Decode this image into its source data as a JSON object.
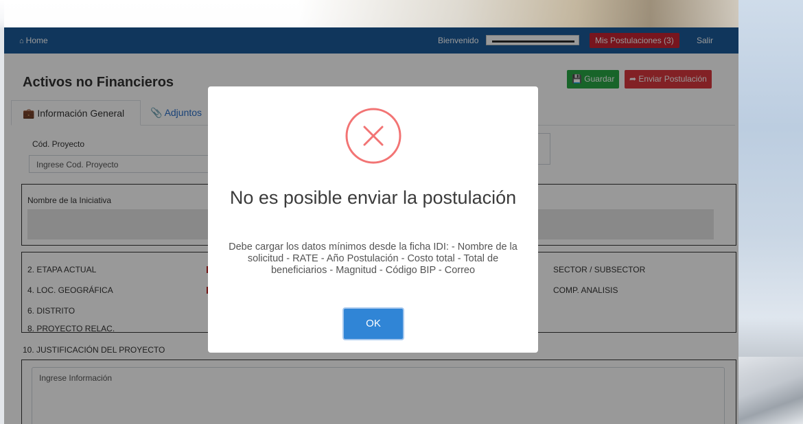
{
  "navbar": {
    "home_label": "Home",
    "home_icon": "house-icon",
    "welcome_label": "Bienvenido",
    "postulaciones_label": "Mis Postulaciones (3)",
    "salir_label": "Salir"
  },
  "page": {
    "title": "Activos no Financieros",
    "guardar_label": "Guardar",
    "enviar_label": "Enviar Postulación",
    "tabs": [
      {
        "label": "Información General",
        "icon": "briefcase-icon"
      },
      {
        "label": "Adjuntos",
        "icon": "paperclip-icon"
      }
    ],
    "cod_proyecto_label": "Cód. Proyecto",
    "cod_proyecto_placeholder": "Ingrese Cod. Proyecto",
    "nombre_iniciativa_label": "Nombre de la Iniciativa",
    "fields_left": [
      "2. ETAPA ACTUAL",
      "4. LOC. GEOGRÁFICA",
      "6. DISTRITO",
      "8. PROYECTO RELAC."
    ],
    "fields_right": [
      "SECTOR / SUBSECTOR",
      "COMP. ANALISIS"
    ],
    "justificacion_label": "10. JUSTIFICACIÓN DEL PROYECTO",
    "justificacion_placeholder": "Ingrese Información"
  },
  "modal": {
    "icon": "error-x-icon",
    "title": "No es posible enviar la postulación",
    "body": "Debe cargar los datos mínimos desde la ficha IDI: - Nombre de la solicitud - RATE - Año Postulación - Costo total - Total de beneficiarios - Magnitud - Código BIP - Correo",
    "ok_label": "OK"
  },
  "colors": {
    "navbar": "#1b5a9a",
    "danger": "#c82333",
    "success": "#28a745",
    "primary": "#3085d6",
    "error_icon": "#f27474"
  }
}
